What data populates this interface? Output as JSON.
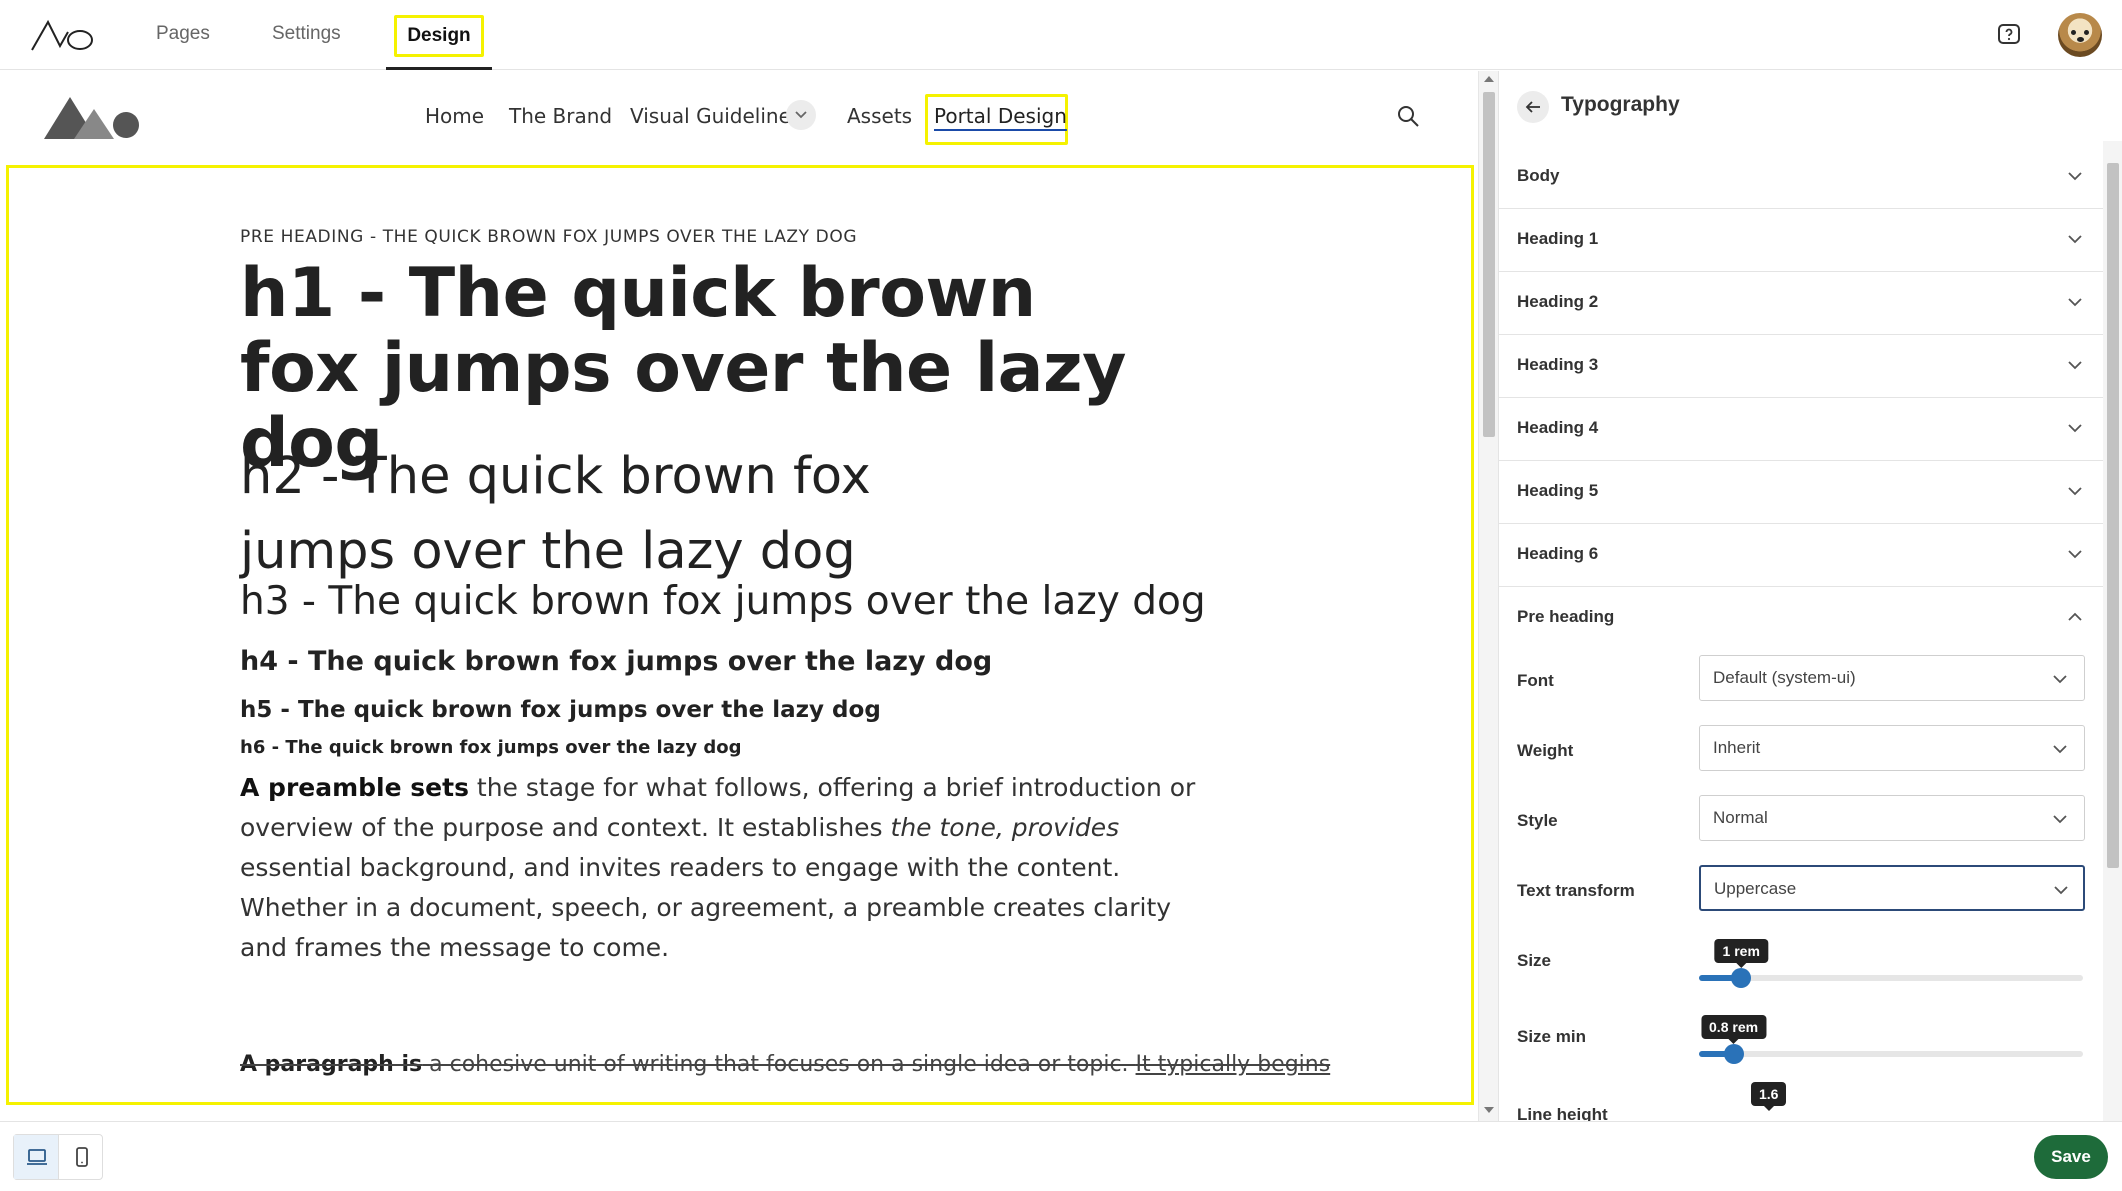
{
  "topbar": {
    "nav": {
      "pages": "Pages",
      "settings": "Settings",
      "design": "Design"
    }
  },
  "site": {
    "nav": {
      "home": "Home",
      "brand": "The Brand",
      "visual": "Visual Guidelines",
      "assets": "Assets",
      "portal": "Portal Design"
    }
  },
  "preview": {
    "pre_heading": "PRE HEADING - THE QUICK BROWN FOX JUMPS OVER THE LAZY DOG",
    "h1": "h1 - The quick brown fox jumps over the lazy dog",
    "h2": "h2 - The quick brown fox jumps over the lazy dog",
    "h3": "h3 - The quick brown fox jumps over the lazy dog",
    "h4": "h4 - The quick brown fox jumps over the lazy dog",
    "h5": "h5 - The quick brown fox jumps over the lazy dog",
    "h6": "h6 - The quick brown fox jumps over the lazy dog",
    "preamble": {
      "bold": "A preamble sets",
      "text1": " the stage for what follows, offering a brief introduction or overview of the purpose and context. It establishes ",
      "italic": "the tone, provides",
      "text2": " essential background, and invites readers to engage with the content. Whether in a document, speech, or agreement, a preamble creates clarity and frames the message to come."
    },
    "paragraph": {
      "bold": "A paragraph is",
      "text": " a cohesive unit of writing that focuses on a single idea or topic. ",
      "link": "It typically begins"
    }
  },
  "panel": {
    "title": "Typography",
    "sections": [
      "Body",
      "Heading 1",
      "Heading 2",
      "Heading 3",
      "Heading 4",
      "Heading 5",
      "Heading 6",
      "Pre heading"
    ],
    "pre_heading": {
      "font_label": "Font",
      "font_value": "Default (system-ui)",
      "weight_label": "Weight",
      "weight_value": "Inherit",
      "style_label": "Style",
      "style_value": "Normal",
      "transform_label": "Text transform",
      "transform_value": "Uppercase",
      "size_label": "Size",
      "size_value": "1 rem",
      "size_fraction": 0.11,
      "size_min_label": "Size min",
      "size_min_value": "0.8 rem",
      "size_min_fraction": 0.09,
      "line_height_label": "Line height",
      "line_height_value": "1.6"
    }
  },
  "bottombar": {
    "save": "Save"
  },
  "colors": {
    "highlight": "#f5f200",
    "accent_blue": "#2a72b8",
    "save_green": "#1e6b3a"
  },
  "icons": [
    "app-logo-icon",
    "help-icon",
    "site-logo-icon",
    "chevron-down-icon",
    "search-icon",
    "back-arrow-icon",
    "laptop-icon",
    "phone-icon"
  ]
}
